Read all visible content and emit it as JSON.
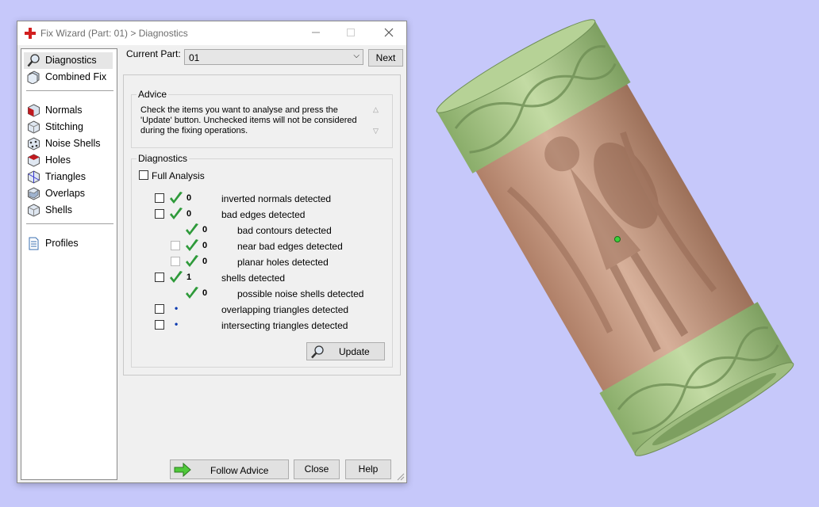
{
  "window": {
    "title": "Fix Wizard (Part: 01) > Diagnostics",
    "minimize_icon": "minimize-icon",
    "maximize_icon": "maximize-icon",
    "close_icon": "close-icon"
  },
  "sidebar": {
    "group1": [
      {
        "label": "Diagnostics",
        "icon": "magnifier-icon",
        "active": true
      },
      {
        "label": "Combined Fix",
        "icon": "combined-fix-icon"
      }
    ],
    "group2": [
      {
        "label": "Normals",
        "icon": "normals-cube-icon"
      },
      {
        "label": "Stitching",
        "icon": "stitching-cube-icon"
      },
      {
        "label": "Noise Shells",
        "icon": "noise-shells-cube-icon"
      },
      {
        "label": "Holes",
        "icon": "holes-cube-icon"
      },
      {
        "label": "Triangles",
        "icon": "triangles-cube-icon"
      },
      {
        "label": "Overlaps",
        "icon": "overlaps-cube-icon"
      },
      {
        "label": "Shells",
        "icon": "shells-cube-icon"
      }
    ],
    "group3": [
      {
        "label": "Profiles",
        "icon": "document-icon"
      }
    ]
  },
  "current_part": {
    "label": "Current Part:",
    "value": "01",
    "next_label": "Next"
  },
  "advice": {
    "title": "Advice",
    "line1": "Check the items you want to analyse and press the",
    "line2": "'Update' button. Unchecked items will not be considered",
    "line3": "during the fixing operations."
  },
  "diagnostics": {
    "title": "Diagnostics",
    "full_analysis_label": "Full Analysis",
    "rows": [
      {
        "label": "inverted normals detected",
        "count": "0",
        "status": "ok",
        "indent": 0,
        "checkbox": "enabled"
      },
      {
        "label": "bad edges detected",
        "count": "0",
        "status": "ok",
        "indent": 0,
        "checkbox": "enabled"
      },
      {
        "label": "bad contours detected",
        "count": "0",
        "status": "ok",
        "indent": 1,
        "checkbox": "none"
      },
      {
        "label": "near bad edges detected",
        "count": "0",
        "status": "ok",
        "indent": 1,
        "checkbox": "disabled"
      },
      {
        "label": "planar holes detected",
        "count": "0",
        "status": "ok",
        "indent": 1,
        "checkbox": "disabled"
      },
      {
        "label": "shells detected",
        "count": "1",
        "status": "ok",
        "indent": 0,
        "checkbox": "enabled"
      },
      {
        "label": "possible noise shells detected",
        "count": "0",
        "status": "ok",
        "indent": 1,
        "checkbox": "none"
      },
      {
        "label": "overlapping triangles detected",
        "count": "•",
        "status": "pending",
        "indent": 0,
        "checkbox": "enabled"
      },
      {
        "label": "intersecting triangles detected",
        "count": "•",
        "status": "pending",
        "indent": 0,
        "checkbox": "enabled"
      }
    ],
    "update_label": "Update"
  },
  "footer": {
    "follow_advice_label": "Follow Advice",
    "close_label": "Close",
    "help_label": "Help"
  },
  "colors": {
    "background": "#c6c8fa",
    "bronze_model": "#c29a7f",
    "green_bands": "#a8c98a",
    "check_green": "#2e9a3a"
  }
}
